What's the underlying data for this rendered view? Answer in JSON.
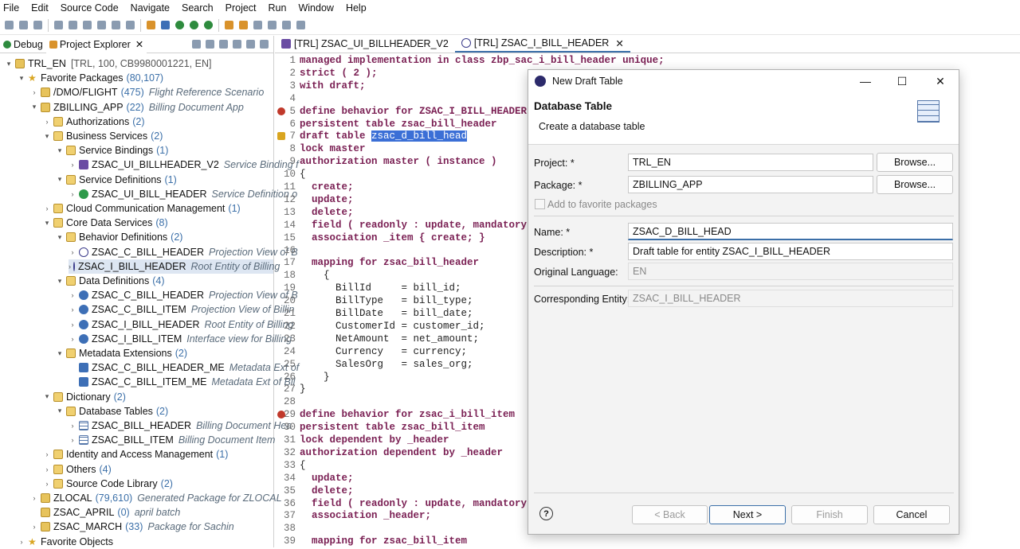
{
  "menu": [
    "File",
    "Edit",
    "Source Code",
    "Navigate",
    "Search",
    "Project",
    "Run",
    "Window",
    "Help"
  ],
  "left_tabs": {
    "debug": "Debug",
    "explorer": "Project Explorer"
  },
  "tree": [
    {
      "label": "TRL_EN",
      "desc": "[TRL, 100, CB9980001221, EN]",
      "count": "",
      "icon": "project",
      "indent": 0,
      "tw": "v"
    },
    {
      "label": "Favorite Packages",
      "count": "(80,107)",
      "desc": "",
      "icon": "star",
      "indent": 1,
      "tw": "v"
    },
    {
      "label": "/DMO/FLIGHT",
      "count": "(475)",
      "desc": "Flight Reference Scenario",
      "icon": "pkg",
      "indent": 2,
      "tw": ">"
    },
    {
      "label": "ZBILLING_APP",
      "count": "(22)",
      "desc": "Billing Document App",
      "icon": "pkg",
      "indent": 2,
      "tw": "v"
    },
    {
      "label": "Authorizations",
      "count": "(2)",
      "desc": "",
      "icon": "fld",
      "indent": 3,
      "tw": ">"
    },
    {
      "label": "Business Services",
      "count": "(2)",
      "desc": "",
      "icon": "fld",
      "indent": 3,
      "tw": "v"
    },
    {
      "label": "Service Bindings",
      "count": "(1)",
      "desc": "",
      "icon": "fld",
      "indent": 4,
      "tw": "v"
    },
    {
      "label": "ZSAC_UI_BILLHEADER_V2",
      "count": "",
      "desc": "Service Binding f",
      "icon": "svc",
      "indent": 5,
      "tw": ">"
    },
    {
      "label": "Service Definitions",
      "count": "(1)",
      "desc": "",
      "icon": "fld",
      "indent": 4,
      "tw": "v"
    },
    {
      "label": "ZSAC_UI_BILL_HEADER",
      "count": "",
      "desc": "Service Definition o",
      "icon": "sd",
      "indent": 5,
      "tw": ">"
    },
    {
      "label": "Cloud Communication Management",
      "count": "(1)",
      "desc": "",
      "icon": "fld",
      "indent": 3,
      "tw": ">"
    },
    {
      "label": "Core Data Services",
      "count": "(8)",
      "desc": "",
      "icon": "fld",
      "indent": 3,
      "tw": "v"
    },
    {
      "label": "Behavior Definitions",
      "count": "(2)",
      "desc": "",
      "icon": "fld",
      "indent": 4,
      "tw": "v"
    },
    {
      "label": "ZSAC_C_BILL_HEADER",
      "count": "",
      "desc": "Projection View of B",
      "icon": "bdef",
      "indent": 5,
      "tw": ">"
    },
    {
      "label": "ZSAC_I_BILL_HEADER",
      "count": "",
      "desc": "Root Entity of Billing",
      "icon": "bdef",
      "indent": 5,
      "tw": ">",
      "selected": true
    },
    {
      "label": "Data Definitions",
      "count": "(4)",
      "desc": "",
      "icon": "fld",
      "indent": 4,
      "tw": "v"
    },
    {
      "label": "ZSAC_C_BILL_HEADER",
      "count": "",
      "desc": "Projection View of B",
      "icon": "ddef",
      "indent": 5,
      "tw": ">"
    },
    {
      "label": "ZSAC_C_BILL_ITEM",
      "count": "",
      "desc": "Projection View of Billin",
      "icon": "ddef",
      "indent": 5,
      "tw": ">"
    },
    {
      "label": "ZSAC_I_BILL_HEADER",
      "count": "",
      "desc": "Root Entity of Billing",
      "icon": "ddef",
      "indent": 5,
      "tw": ">"
    },
    {
      "label": "ZSAC_I_BILL_ITEM",
      "count": "",
      "desc": "Interface view for Billing",
      "icon": "ddef",
      "indent": 5,
      "tw": ">"
    },
    {
      "label": "Metadata Extensions",
      "count": "(2)",
      "desc": "",
      "icon": "fld",
      "indent": 4,
      "tw": "v"
    },
    {
      "label": "ZSAC_C_BILL_HEADER_ME",
      "count": "",
      "desc": "Metadata Ext of",
      "icon": "meta",
      "indent": 5,
      "tw": ""
    },
    {
      "label": "ZSAC_C_BILL_ITEM_ME",
      "count": "",
      "desc": "Metadata Ext of Bil",
      "icon": "meta",
      "indent": 5,
      "tw": ""
    },
    {
      "label": "Dictionary",
      "count": "(2)",
      "desc": "",
      "icon": "fld",
      "indent": 3,
      "tw": "v"
    },
    {
      "label": "Database Tables",
      "count": "(2)",
      "desc": "",
      "icon": "fld",
      "indent": 4,
      "tw": "v"
    },
    {
      "label": "ZSAC_BILL_HEADER",
      "count": "",
      "desc": "Billing Document Hea",
      "icon": "tbl",
      "indent": 5,
      "tw": ">"
    },
    {
      "label": "ZSAC_BILL_ITEM",
      "count": "",
      "desc": "Billing Document Item",
      "icon": "tbl",
      "indent": 5,
      "tw": ">"
    },
    {
      "label": "Identity and Access Management",
      "count": "(1)",
      "desc": "",
      "icon": "fld",
      "indent": 3,
      "tw": ">"
    },
    {
      "label": "Others",
      "count": "(4)",
      "desc": "",
      "icon": "fld",
      "indent": 3,
      "tw": ">"
    },
    {
      "label": "Source Code Library",
      "count": "(2)",
      "desc": "",
      "icon": "fld",
      "indent": 3,
      "tw": ">"
    },
    {
      "label": "ZLOCAL",
      "count": "(79,610)",
      "desc": "Generated Package for ZLOCAL",
      "icon": "pkg",
      "indent": 2,
      "tw": ">"
    },
    {
      "label": "ZSAC_APRIL",
      "count": "(0)",
      "desc": "april batch",
      "icon": "pkg",
      "indent": 2,
      "tw": ""
    },
    {
      "label": "ZSAC_MARCH",
      "count": "(33)",
      "desc": "Package for Sachin",
      "icon": "pkg",
      "indent": 2,
      "tw": ">"
    },
    {
      "label": "Favorite Objects",
      "count": "",
      "desc": "",
      "icon": "star",
      "indent": 1,
      "tw": ">"
    }
  ],
  "editor_tabs": [
    "[TRL] ZSAC_UI_BILLHEADER_V2",
    "[TRL] ZSAC_I_BILL_HEADER"
  ],
  "code": [
    {
      "n": "1",
      "t": "managed implementation in class zbp_sac_i_bill_header unique;"
    },
    {
      "n": "2",
      "t": "strict ( 2 );"
    },
    {
      "n": "3",
      "t": "with draft;"
    },
    {
      "n": "4",
      "t": ""
    },
    {
      "n": "5",
      "t": "define behavior for ZSAC_I_BILL_HEADER",
      "mark": "err"
    },
    {
      "n": "6",
      "t": "persistent table zsac_bill_header"
    },
    {
      "n": "7",
      "t": "draft table ",
      "hl": "zsac_d_bill_head",
      "mark": "warn"
    },
    {
      "n": "8",
      "t": "lock master"
    },
    {
      "n": "9",
      "t": "authorization master ( instance )"
    },
    {
      "n": "10",
      "t": "{"
    },
    {
      "n": "11",
      "t": "  create;"
    },
    {
      "n": "12",
      "t": "  update;"
    },
    {
      "n": "13",
      "t": "  delete;"
    },
    {
      "n": "14",
      "t": "  field ( readonly : update, mandatory"
    },
    {
      "n": "15",
      "t": "  association _item { create; }"
    },
    {
      "n": "16",
      "t": ""
    },
    {
      "n": "17",
      "t": "  mapping for zsac_bill_header"
    },
    {
      "n": "18",
      "t": "    {"
    },
    {
      "n": "19",
      "t": "      BillId     = bill_id;"
    },
    {
      "n": "20",
      "t": "      BillType   = bill_type;"
    },
    {
      "n": "21",
      "t": "      BillDate   = bill_date;"
    },
    {
      "n": "22",
      "t": "      CustomerId = customer_id;"
    },
    {
      "n": "23",
      "t": "      NetAmount  = net_amount;"
    },
    {
      "n": "24",
      "t": "      Currency   = currency;"
    },
    {
      "n": "25",
      "t": "      SalesOrg   = sales_org;"
    },
    {
      "n": "26",
      "t": "    }"
    },
    {
      "n": "27",
      "t": "}"
    },
    {
      "n": "28",
      "t": ""
    },
    {
      "n": "29",
      "t": "define behavior for zsac_i_bill_item",
      "mark": "err"
    },
    {
      "n": "30",
      "t": "persistent table zsac_bill_item"
    },
    {
      "n": "31",
      "t": "lock dependent by _header"
    },
    {
      "n": "32",
      "t": "authorization dependent by _header"
    },
    {
      "n": "33",
      "t": "{"
    },
    {
      "n": "34",
      "t": "  update;"
    },
    {
      "n": "35",
      "t": "  delete;"
    },
    {
      "n": "36",
      "t": "  field ( readonly : update, mandatory"
    },
    {
      "n": "37",
      "t": "  association _header;"
    },
    {
      "n": "38",
      "t": ""
    },
    {
      "n": "39",
      "t": "  mapping for zsac_bill_item"
    }
  ],
  "dialog": {
    "title": "New Draft Table",
    "heading": "Database Table",
    "subheading": "Create a database table",
    "project_label": "Project: *",
    "project_value": "TRL_EN",
    "package_label": "Package: *",
    "package_value": "ZBILLING_APP",
    "browse": "Browse...",
    "favorite_label": "Add to favorite packages",
    "name_label": "Name: *",
    "name_value": "ZSAC_D_BILL_HEAD",
    "description_label": "Description: *",
    "description_value": "Draft table for entity ZSAC_I_BILL_HEADER",
    "language_label": "Original Language:",
    "language_value": "EN",
    "entity_label": "Corresponding Entity:",
    "entity_value": "ZSAC_I_BILL_HEADER",
    "back": "< Back",
    "next": "Next >",
    "finish": "Finish",
    "cancel": "Cancel"
  }
}
